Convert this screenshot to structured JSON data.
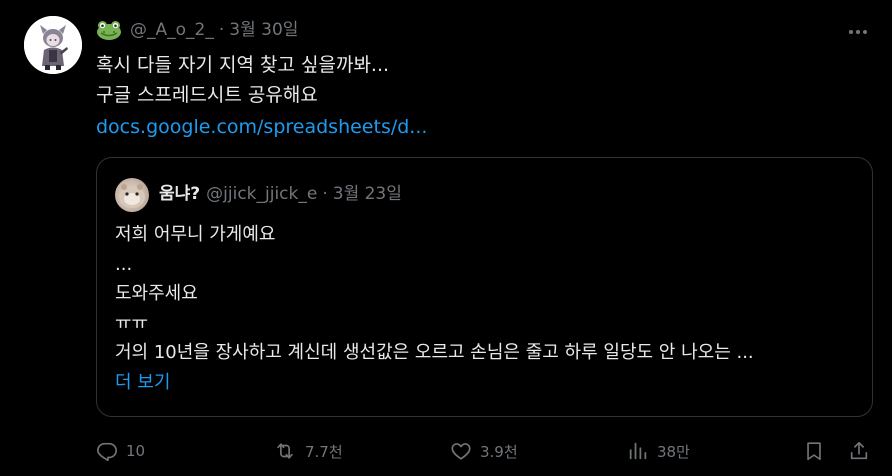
{
  "tweet": {
    "author_emoji": "frog-emoji",
    "handle": "@_A_o_2_",
    "separator": "·",
    "date": "3월 30일",
    "body_lines": [
      "혹시 다들 자기 지역 찾고 싶을까봐...",
      "구글 스프레드시트 공유해요"
    ],
    "link": "docs.google.com/spreadsheets/d..."
  },
  "quote": {
    "name": "움냐?",
    "handle": "@jjick_jjick_e",
    "separator": "·",
    "date": "3월 23일",
    "lines": [
      "저희 어무니 가게예요",
      "...",
      "도와주세요",
      "ㅠㅠ",
      "거의 10년을 장사하고 계신데 생선값은 오르고 손님은 줄고 하루 일당도 안 나오는 ..."
    ],
    "show_more": "더 보기"
  },
  "actions": {
    "replies": "10",
    "reposts": "7.7천",
    "likes": "3.9천",
    "views": "38만"
  },
  "colors": {
    "background": "#000000",
    "text": "#e7e9ea",
    "muted": "#71767b",
    "link": "#1d9bf0",
    "border": "#2f3336"
  }
}
